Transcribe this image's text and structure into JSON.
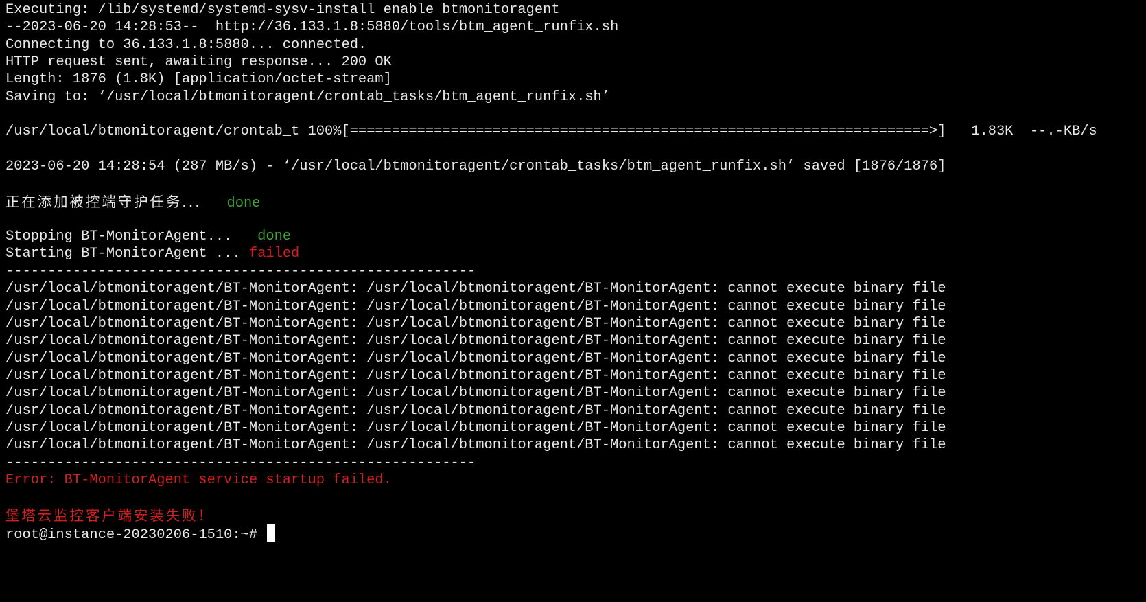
{
  "colors": {
    "background": "#000000",
    "foreground": "#e8e8e8",
    "success": "#3fa236",
    "error": "#d22020"
  },
  "lines": {
    "l1": "Executing: /lib/systemd/systemd-sysv-install enable btmonitoragent",
    "l2": "--2023-06-20 14:28:53--  http://36.133.1.8:5880/tools/btm_agent_runfix.sh",
    "l3": "Connecting to 36.133.1.8:5880... connected.",
    "l4": "HTTP request sent, awaiting response... 200 OK",
    "l5": "Length: 1876 (1.8K) [application/octet-stream]",
    "l6": "Saving to: ‘/usr/local/btmonitoragent/crontab_tasks/btm_agent_runfix.sh’"
  },
  "progress": {
    "filename": "/usr/local/btmonitoragent/crontab_t",
    "percent": "100%",
    "bar": "[=====================================================================>]",
    "size": "1.83K",
    "speed": "--.-KB/s"
  },
  "saved_line": "2023-06-20 14:28:54 (287 MB/s) - ‘/usr/local/btmonitoragent/crontab_tasks/btm_agent_runfix.sh’ saved [1876/1876]",
  "guard_task": {
    "label": "正在添加被控端守护任务...",
    "status": "done"
  },
  "stopping": {
    "label": "Stopping BT-MonitorAgent...",
    "status": "done"
  },
  "starting": {
    "label": "Starting BT-MonitorAgent ...",
    "status": "failed"
  },
  "separator": "--------------------------------------------------------",
  "error_lines": [
    "/usr/local/btmonitoragent/BT-MonitorAgent: /usr/local/btmonitoragent/BT-MonitorAgent: cannot execute binary file",
    "/usr/local/btmonitoragent/BT-MonitorAgent: /usr/local/btmonitoragent/BT-MonitorAgent: cannot execute binary file",
    "/usr/local/btmonitoragent/BT-MonitorAgent: /usr/local/btmonitoragent/BT-MonitorAgent: cannot execute binary file",
    "/usr/local/btmonitoragent/BT-MonitorAgent: /usr/local/btmonitoragent/BT-MonitorAgent: cannot execute binary file",
    "/usr/local/btmonitoragent/BT-MonitorAgent: /usr/local/btmonitoragent/BT-MonitorAgent: cannot execute binary file",
    "/usr/local/btmonitoragent/BT-MonitorAgent: /usr/local/btmonitoragent/BT-MonitorAgent: cannot execute binary file",
    "/usr/local/btmonitoragent/BT-MonitorAgent: /usr/local/btmonitoragent/BT-MonitorAgent: cannot execute binary file",
    "/usr/local/btmonitoragent/BT-MonitorAgent: /usr/local/btmonitoragent/BT-MonitorAgent: cannot execute binary file",
    "/usr/local/btmonitoragent/BT-MonitorAgent: /usr/local/btmonitoragent/BT-MonitorAgent: cannot execute binary file",
    "/usr/local/btmonitoragent/BT-MonitorAgent: /usr/local/btmonitoragent/BT-MonitorAgent: cannot execute binary file"
  ],
  "error_message": "Error: BT-MonitorAgent service startup failed.",
  "install_failed": "堡塔云监控客户端安装失败！",
  "prompt": "root@instance-20230206-1510:~#"
}
